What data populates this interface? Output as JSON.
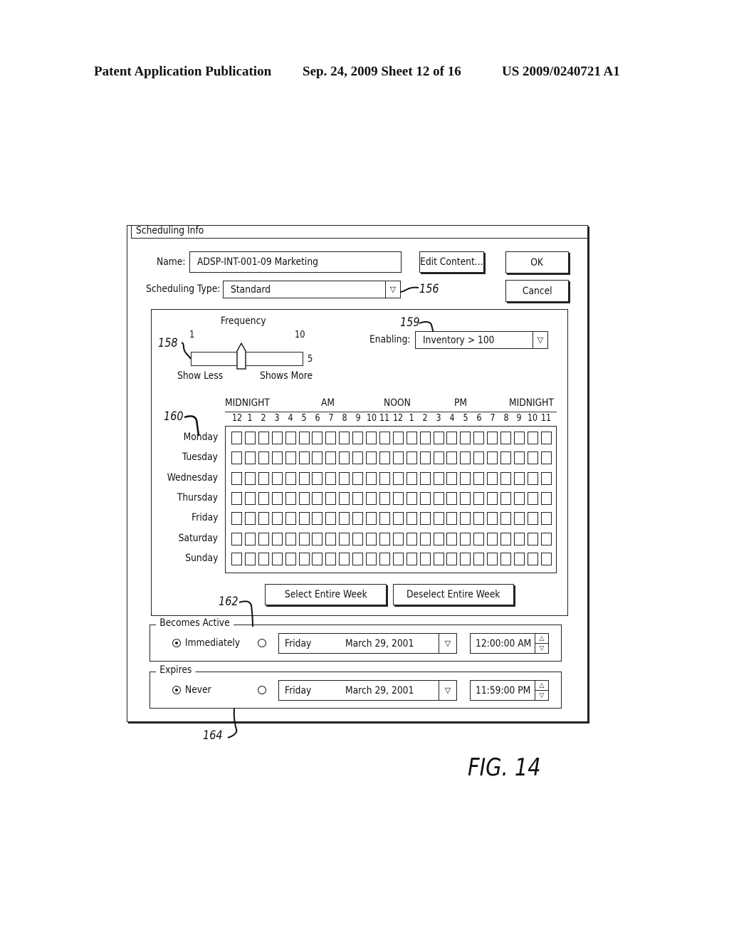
{
  "header": {
    "publication": "Patent Application Publication",
    "date_sheet": "Sep. 24, 2009   Sheet 12 of 16",
    "patent_number": "US 2009/0240721 A1"
  },
  "dialog": {
    "title": "Scheduling Info",
    "name_label": "Name:",
    "name_value": "ADSP-INT-001-09 Marketing",
    "edit_content_label": "Edit Content...",
    "ok_label": "OK",
    "cancel_label": "Cancel",
    "scheduling_type_label": "Scheduling Type:",
    "scheduling_type_value": "Standard",
    "frequency": {
      "label": "Frequency",
      "min_label": "1",
      "max_label": "10",
      "value_label": "5",
      "value_fraction": 0.45,
      "left_caption": "Show Less",
      "right_caption": "Shows More"
    },
    "enabling_label": "Enabling:",
    "enabling_value": "Inventory > 100",
    "schedule_grid": {
      "period_labels": [
        "MIDNIGHT",
        "AM",
        "NOON",
        "PM",
        "MIDNIGHT"
      ],
      "hours": [
        "12",
        "1",
        "2",
        "3",
        "4",
        "5",
        "6",
        "7",
        "8",
        "9",
        "10",
        "11",
        "12",
        "1",
        "2",
        "3",
        "4",
        "5",
        "6",
        "7",
        "8",
        "9",
        "10",
        "11"
      ],
      "days": [
        "Monday",
        "Tuesday",
        "Wednesday",
        "Thursday",
        "Friday",
        "Saturday",
        "Sunday"
      ],
      "selected": []
    },
    "select_week_label": "Select Entire Week",
    "deselect_week_label": "Deselect Entire Week",
    "becomes_active": {
      "legend": "Becomes Active",
      "immediately_label": "Immediately",
      "immediately_selected": true,
      "date_day": "Friday",
      "date_value": "March 29, 2001",
      "time_value": "12:00:00 AM"
    },
    "expires": {
      "legend": "Expires",
      "never_label": "Never",
      "never_selected": true,
      "date_day": "Friday",
      "date_value": "March 29, 2001",
      "time_value": "11:59:00 PM"
    }
  },
  "reference_numerals": {
    "r156": "156",
    "r158": "158",
    "r159": "159",
    "r160": "160",
    "r162": "162",
    "r164": "164"
  },
  "figure_label": "FIG. 14",
  "icons": {
    "dropdown": "▽",
    "spin_up": "△",
    "spin_down": "▽"
  }
}
